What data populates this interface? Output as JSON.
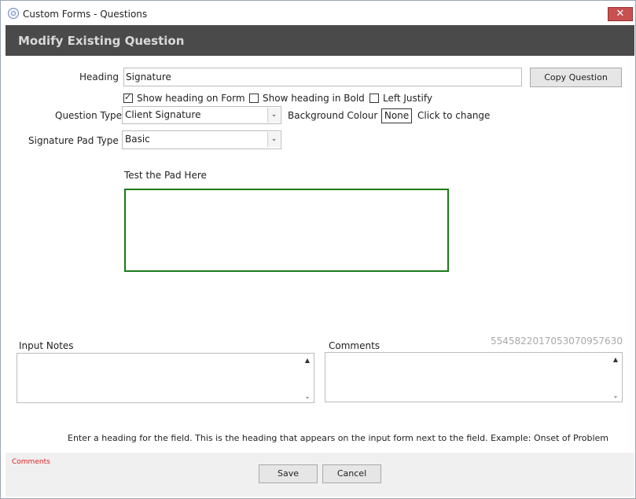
{
  "window": {
    "title": "Custom Forms - Questions",
    "close_glyph": "✕"
  },
  "header": {
    "title": "Modify Existing Question"
  },
  "heading": {
    "label": "Heading",
    "value": "Signature",
    "copy_button": "Copy Question"
  },
  "checkboxes": [
    {
      "label": "Show heading on Form",
      "checked": true
    },
    {
      "label": "Show heading in Bold",
      "checked": false
    },
    {
      "label": "Left Justify",
      "checked": false
    }
  ],
  "question_type": {
    "label": "Question Type",
    "value": "Client Signature"
  },
  "background_colour": {
    "label": "Background Colour",
    "value": "None",
    "hint": "Click to change"
  },
  "signature_pad_type": {
    "label": "Signature Pad Type",
    "value": "Basic"
  },
  "test_pad": {
    "label": "Test the Pad Here",
    "border_color": "#1a7a1a"
  },
  "input_notes": {
    "label": "Input Notes"
  },
  "comments": {
    "label": "Comments",
    "id_text": "5545822017053070957630"
  },
  "help_text": "Enter a heading for the field. This is the heading that appears on the input form next to the field. Example: Onset of Problem",
  "footer": {
    "comments_label": "Comments",
    "save": "Save",
    "cancel": "Cancel"
  },
  "icons": {
    "dropdown": "chevron-down-icon",
    "scroll_up": "scroll-up-icon",
    "scroll_down": "scroll-down-icon"
  },
  "colors": {
    "header_bg": "#4a4a4a",
    "close_bg": "#c75050",
    "footer_comments": "#e02020"
  }
}
